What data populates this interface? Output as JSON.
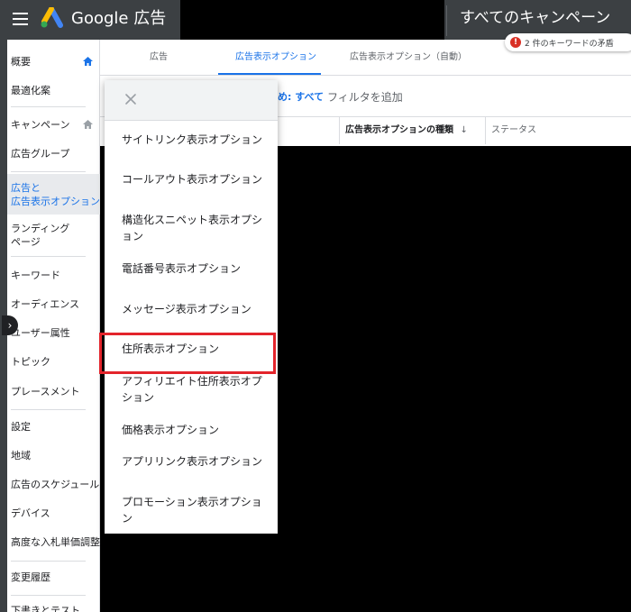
{
  "app": {
    "brand": "Google 広告",
    "campaign_title": "すべてのキャンペーン",
    "notice": "2 件のキーワードの矛盾",
    "notice_icon": "alert-icon"
  },
  "tabs": [
    {
      "label": "広告"
    },
    {
      "label": "広告表示オプション",
      "active": true
    },
    {
      "label": "広告表示オプション（自動）"
    }
  ],
  "filter": {
    "label": "め: すべて",
    "add": "フィルタを追加"
  },
  "columns": {
    "type": "広告表示オプションの種類",
    "sort_icon": "↓",
    "status": "ステータス"
  },
  "sidebar": {
    "items": [
      {
        "label": "概要"
      },
      {
        "label": "最適化案"
      },
      {
        "label": "キャンペーン"
      },
      {
        "label": "広告グループ"
      },
      {
        "label_line1": "広告と",
        "label_line2": "広告表示オプション",
        "active": true
      },
      {
        "label_line1": "ランディング",
        "label_line2": "ページ"
      },
      {
        "label": "キーワード"
      },
      {
        "label": "オーディエンス"
      },
      {
        "label": "ユーザー属性"
      },
      {
        "label": "トピック"
      },
      {
        "label": "プレースメント"
      },
      {
        "label": "設定"
      },
      {
        "label": "地域"
      },
      {
        "label": "広告のスケジュール"
      },
      {
        "label": "デバイス"
      },
      {
        "label": "高度な入札単価調整"
      },
      {
        "label": "変更履歴"
      },
      {
        "label": "下書きとテスト"
      }
    ],
    "collapse_icon": "›"
  },
  "menu": {
    "close_icon": "close-icon",
    "items": [
      {
        "label": "サイトリンク表示オプション"
      },
      {
        "label": "コールアウト表示オプション"
      },
      {
        "label": "構造化スニペット表示オプション"
      },
      {
        "label": "電話番号表示オプション"
      },
      {
        "label": "メッセージ表示オプション"
      },
      {
        "label": "住所表示オプション",
        "highlighted": true
      },
      {
        "label": "アフィリエイト住所表示オプション"
      },
      {
        "label": "価格表示オプション"
      },
      {
        "label": "アプリリンク表示オプション"
      },
      {
        "label": "プロモーション表示オプション"
      }
    ]
  },
  "colors": {
    "topbar": "#3c4043",
    "accent": "#1a73e8",
    "highlight": "#e3242b"
  }
}
